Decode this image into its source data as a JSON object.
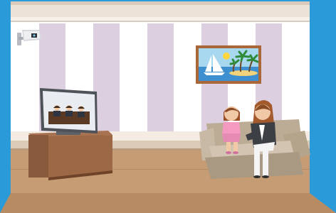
{
  "scene": {
    "colors": {
      "frame": "#2b9ad8",
      "wall": "#ffffff",
      "stripe": "#dccfe0",
      "floor": "#c69c74",
      "sofa": "#c8b9a4",
      "tv_stand": "#8a5a3c",
      "painting_frame": "#a9673a"
    },
    "icons": {
      "camera": "security-camera-icon",
      "boat": "sailboat-icon",
      "sun": "sun-icon"
    }
  }
}
